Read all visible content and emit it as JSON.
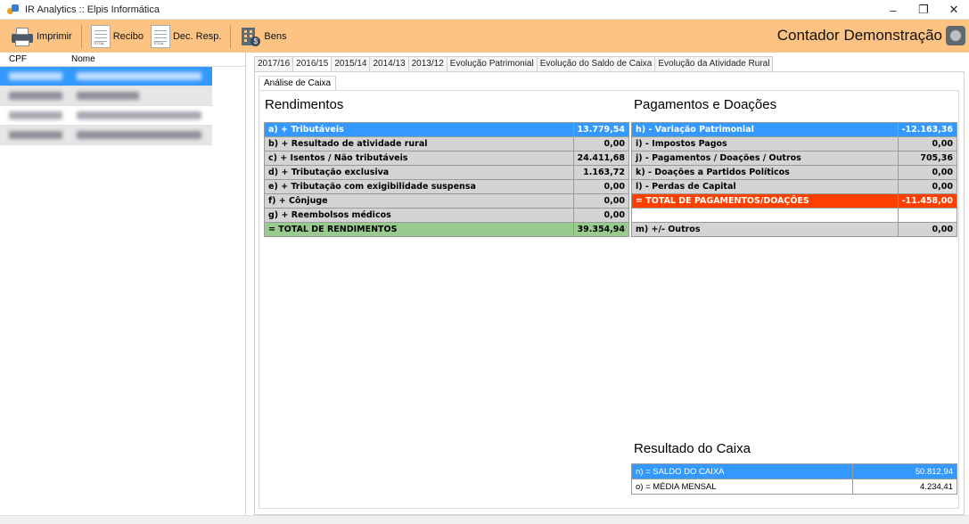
{
  "window": {
    "title": "IR Analytics :: Elpis Informática",
    "minimize": "–",
    "restore": "❐",
    "close": "✕"
  },
  "toolbar": {
    "print_label": "Imprimir",
    "receipt_label": "Recibo",
    "receipt_doc_text": "TOTAL",
    "dec_resp_label": "Dec. Resp.",
    "dec_resp_doc_text": "TOTAL",
    "bens_label": "Bens",
    "user_name": "Contador Demonstração"
  },
  "client_list": {
    "columns": [
      "CPF",
      "Nome"
    ],
    "rows_redacted": 4,
    "selected_index": 0
  },
  "tabs": [
    "2017/16",
    "2016/15",
    "2015/14",
    "2014/13",
    "2013/12",
    "Evolução Patrimonial",
    "Evolução do Saldo de Caixa",
    "Evolução da Atividade Rural"
  ],
  "active_tab": "2016/15",
  "subtab": "Análise de Caixa",
  "rendimentos": {
    "title": "Rendimentos",
    "rows": [
      {
        "label": "a) + Tributáveis",
        "value": "13.779,54"
      },
      {
        "label": "b) + Resultado de atividade rural",
        "value": "0,00"
      },
      {
        "label": "c) + Isentos / Não tributáveis",
        "value": "24.411,68"
      },
      {
        "label": "d) + Tributação exclusiva",
        "value": "1.163,72"
      },
      {
        "label": "e) + Tributação com exigibilidade suspensa",
        "value": "0,00"
      },
      {
        "label": "f) + Cônjuge",
        "value": "0,00"
      },
      {
        "label": "g) + Reembolsos médicos",
        "value": "0,00"
      },
      {
        "label": "= TOTAL DE RENDIMENTOS",
        "value": "39.354,94"
      }
    ]
  },
  "pagamentos": {
    "title": "Pagamentos e Doações",
    "rows": [
      {
        "label": "h) - Variação Patrimonial",
        "value": "-12.163,36"
      },
      {
        "label": "i) - Impostos Pagos",
        "value": "0,00"
      },
      {
        "label": "j) - Pagamentos / Doações / Outros",
        "value": "705,36"
      },
      {
        "label": "k) - Doações a Partidos Políticos",
        "value": "0,00"
      },
      {
        "label": "l) - Perdas de Capital",
        "value": "0,00"
      },
      {
        "label": "= TOTAL DE PAGAMENTOS/DOAÇÕES",
        "value": "-11.458,00"
      },
      {
        "label": "",
        "value": ""
      },
      {
        "label": "m) +/- Outros",
        "value": "0,00"
      }
    ]
  },
  "resultado": {
    "title": "Resultado do Caixa",
    "rows": [
      {
        "label": "n) = SALDO DO CAIXA",
        "value": "50.812,94"
      },
      {
        "label": "o) = MÉDIA MENSAL",
        "value": "4.234,41"
      }
    ]
  },
  "colors": {
    "toolbar_bg": "#fcc383",
    "selection_blue": "#3399ff",
    "total_green": "#98cc8e",
    "total_red": "#ff4000",
    "cell_gray": "#d4d4d4"
  }
}
